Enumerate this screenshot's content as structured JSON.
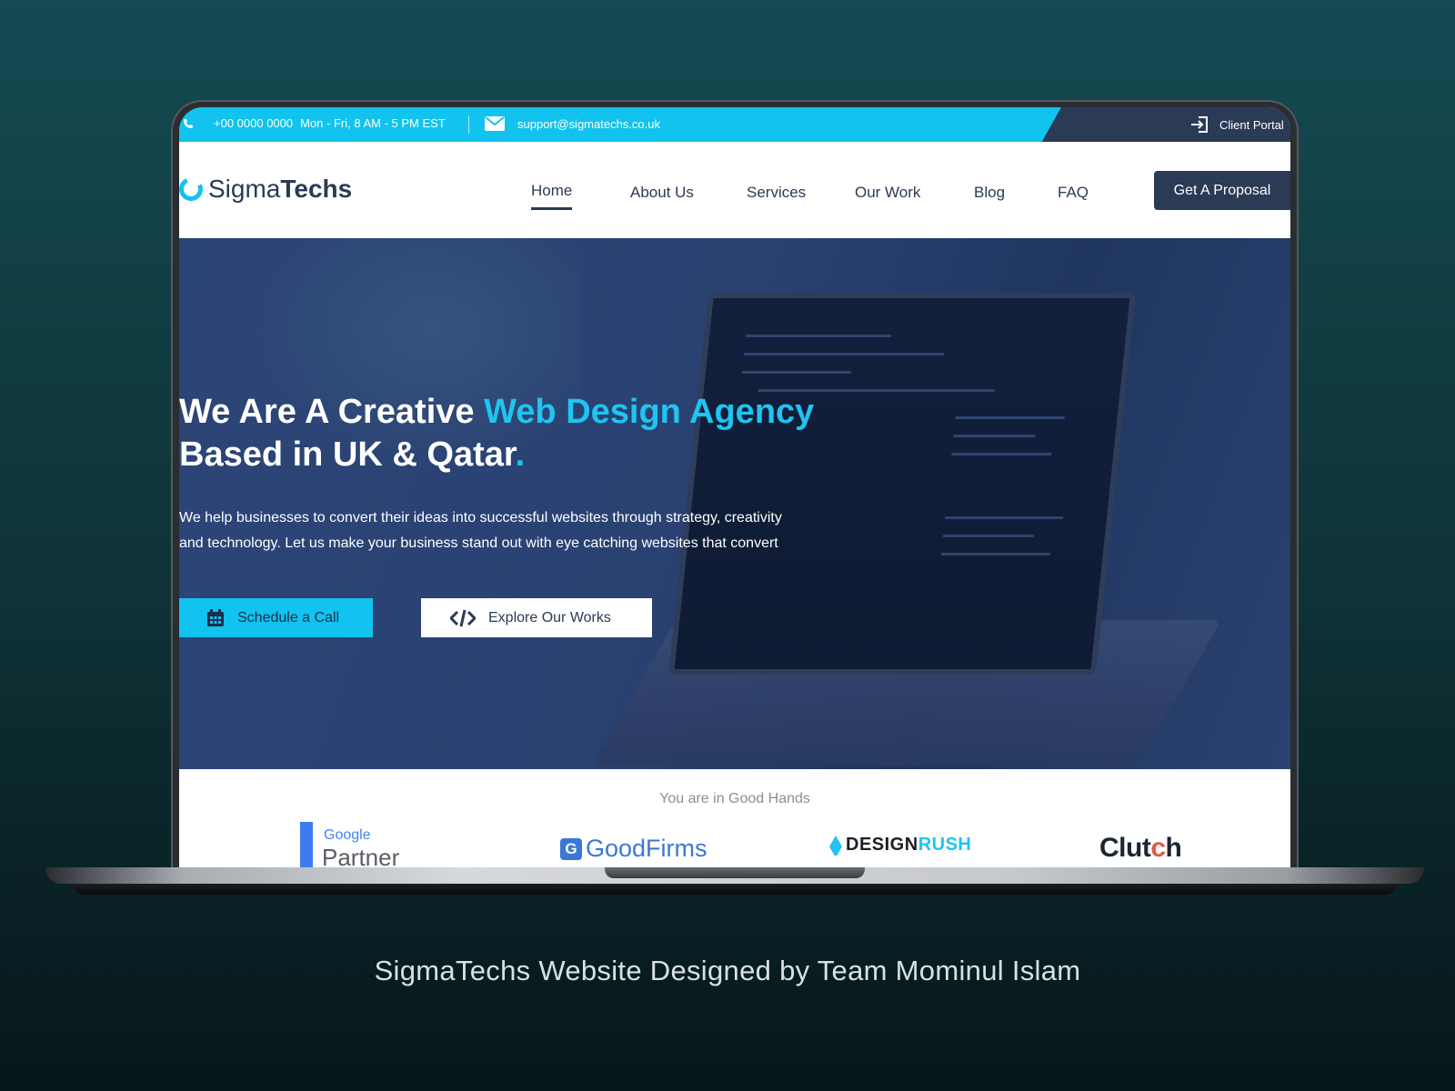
{
  "topbar": {
    "phone": "+00 0000 0000",
    "hours": "Mon - Fri, 8 AM - 5 PM EST",
    "email": "support@sigmatechs.co.uk",
    "client_portal": "Client Portal"
  },
  "logo": {
    "part1": "Sigma",
    "part2": "Techs"
  },
  "nav": {
    "items": [
      {
        "label": "Home",
        "active": true
      },
      {
        "label": "About Us"
      },
      {
        "label": "Services"
      },
      {
        "label": "Our Work"
      },
      {
        "label": "Blog"
      },
      {
        "label": "FAQ"
      }
    ],
    "cta": "Get A Proposal"
  },
  "hero": {
    "title_part1": "We Are A Creative ",
    "title_accent": "Web Design Agency",
    "title_part2": "Based in UK & Qatar",
    "title_dot": ".",
    "description_line1": "We help businesses to convert their ideas into successful websites through strategy, creativity",
    "description_line2": "and technology. Let us make your business stand out with eye catching websites that convert",
    "btn_call": "Schedule a Call",
    "btn_works": "Explore Our Works"
  },
  "trust": {
    "title": "You are in Good Hands",
    "google_word": "Google",
    "google_partner": "Partner",
    "goodfirms": "GoodFirms",
    "goodfirms_mark": "G",
    "designrush_a": "DESIGN",
    "designrush_b": "RUSH",
    "clutch_a": "Clut",
    "clutch_dot": "c",
    "clutch_b": "h"
  },
  "caption": "SigmaTechs Website Designed by Team Mominul Islam",
  "colors": {
    "accent": "#11c3ee",
    "navy": "#2b3a55",
    "hero_overlay": "#2c4577"
  }
}
